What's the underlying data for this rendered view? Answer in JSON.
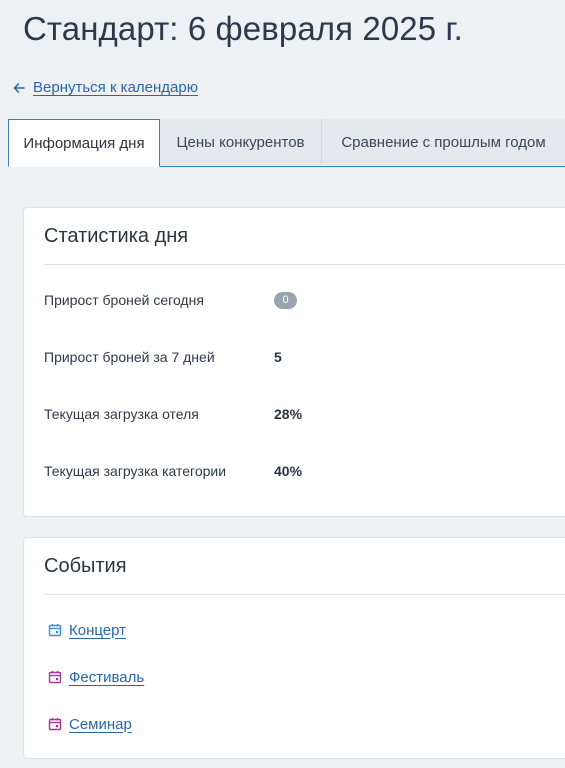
{
  "page": {
    "title": "Стандарт: 6 февраля 2025 г."
  },
  "back_link": {
    "label": "Вернуться к календарю",
    "icon": "arrow-left-icon"
  },
  "tabs": [
    {
      "label": "Информация дня",
      "active": true
    },
    {
      "label": "Цены конкурентов",
      "active": false
    },
    {
      "label": "Сравнение с прошлым годом",
      "active": false
    }
  ],
  "stats_card": {
    "title": "Статистика дня",
    "rows": [
      {
        "label": "Прирост броней сегодня",
        "value": "0",
        "style": "badge"
      },
      {
        "label": "Прирост броней за 7 дней",
        "value": "5",
        "style": "bold"
      },
      {
        "label": "Текущая загрузка отеля",
        "value": "28%",
        "style": "bold"
      },
      {
        "label": "Текущая загрузка категории",
        "value": "40%",
        "style": "bold"
      }
    ]
  },
  "events_card": {
    "title": "События",
    "items": [
      {
        "label": "Концерт",
        "icon": "calendar-icon",
        "icon_color": "#3b8fd6"
      },
      {
        "label": "Фестиваль",
        "icon": "calendar-icon",
        "icon_color": "#a0379b"
      },
      {
        "label": "Семинар",
        "icon": "calendar-icon",
        "icon_color": "#a0379b"
      }
    ]
  },
  "colors": {
    "background": "#eef1f4",
    "link": "#2a66a8",
    "tab_active_border": "#3d7fc4",
    "badge": "#9aa4b0"
  }
}
